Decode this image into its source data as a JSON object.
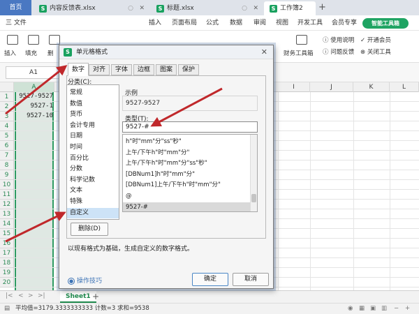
{
  "titlebar": {
    "home_tab": "首页",
    "tabs": [
      "内容反馈表.xlsx",
      "标题.xlsx",
      "工作簿2"
    ],
    "add_label": "+"
  },
  "menubar": {
    "items": [
      "三 文件",
      "插入",
      "页面布局",
      "公式",
      "数据",
      "审阅",
      "视图",
      "开发工具",
      "会员专享"
    ],
    "smart_tool": "智能工具箱"
  },
  "ribbon": {
    "insert": "插入",
    "fill": "填充",
    "delete_partial": "删",
    "finance_tool": "财务工具箱",
    "help": [
      "使用说明",
      "问题反馈"
    ],
    "vip": [
      "开通会员",
      "关闭工具"
    ]
  },
  "formulabar": {
    "namebox": "A1"
  },
  "grid": {
    "columns": [
      "A",
      "I",
      "J",
      "K",
      "L"
    ],
    "rows": [
      "1",
      "2",
      "3",
      "4",
      "5",
      "6",
      "7",
      "8",
      "9",
      "10",
      "11",
      "12",
      "13",
      "14",
      "15",
      "16",
      "17",
      "18",
      "19",
      "20"
    ],
    "cells": [
      "9527-9527",
      "9527-1",
      "9527-10"
    ]
  },
  "sheetbar": {
    "tab": "Sheet1",
    "add": "+"
  },
  "statusbar": {
    "text": "平均值=3179.3333333333  计数=3  求和=9538"
  },
  "dialog": {
    "title": "单元格格式",
    "tabs": [
      "数字",
      "对齐",
      "字体",
      "边框",
      "图案",
      "保护"
    ],
    "category_label": "分类(C):",
    "categories": [
      "常规",
      "数值",
      "货币",
      "会计专用",
      "日期",
      "时间",
      "百分比",
      "分数",
      "科学记数",
      "文本",
      "特殊",
      "自定义"
    ],
    "selected_category": "自定义",
    "sample_label": "示例",
    "sample_value": "9527-9527",
    "type_label": "类型(T):",
    "type_value": "9527-#",
    "formats": [
      "h\"时\"mm\"分\"ss\"秒\"",
      "上午/下午h\"时\"mm\"分\"",
      "上午/下午h\"时\"mm\"分\"ss\"秒\"",
      "[DBNum1]h\"时\"mm\"分\"",
      "[DBNum1]上午/下午h\"时\"mm\"分\"",
      "@",
      "9527-#"
    ],
    "selected_format": "9527-#",
    "delete_button": "删除(D)",
    "description": "以现有格式为基础，生成自定义的数字格式。",
    "tips_link": "操作技巧",
    "ok_button": "确定",
    "cancel_button": "取消"
  },
  "colors": {
    "accent_green": "#1fa463",
    "arrow_red": "#c0282b",
    "selection_blue": "#cde3f7"
  }
}
